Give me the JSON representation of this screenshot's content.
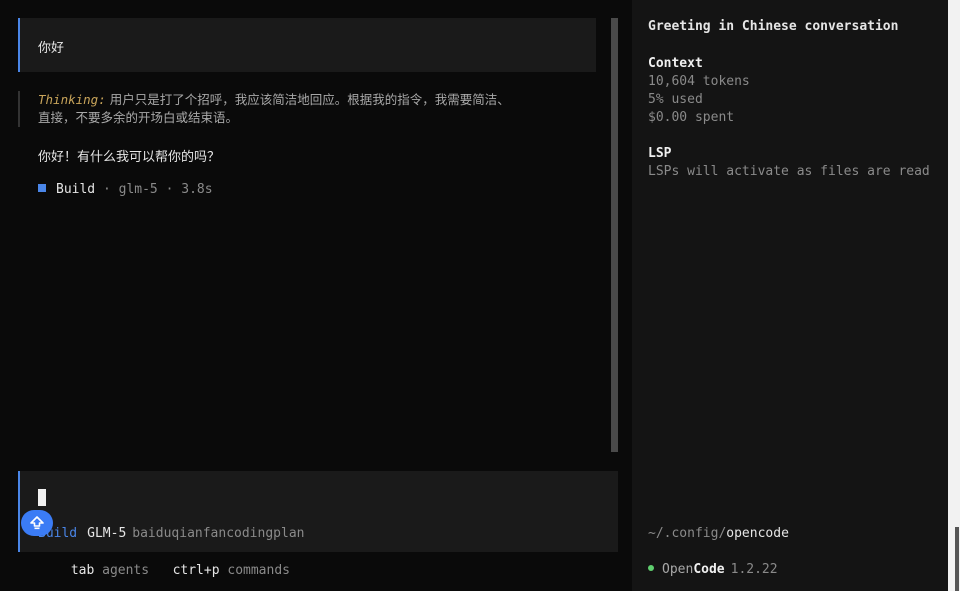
{
  "conversation": {
    "user_message": "你好",
    "thinking_label": "Thinking:",
    "thinking_line1": "用户只是打了个招呼，我应该简洁地回应。根据我的指令，我需要简洁、",
    "thinking_line2": "直接，不要多余的开场白或结束语。",
    "assistant_reply": "你好！有什么我可以帮你的吗？",
    "build": {
      "agent": "Build",
      "sep1": "·",
      "model": "glm-5",
      "sep2": "·",
      "duration": "3.8s"
    }
  },
  "input": {
    "agent": "Build",
    "model": "GLM-5",
    "provider": "baiduqianfancodingplan"
  },
  "hints": {
    "tab_key": "tab",
    "tab_desc": "agents",
    "cmd_key": "ctrl+p",
    "cmd_desc": "commands"
  },
  "sidebar": {
    "title": "Greeting in Chinese conversation",
    "context": {
      "heading": "Context",
      "tokens": "10,604 tokens",
      "used": "5% used",
      "spent": "$0.00 spent"
    },
    "lsp": {
      "heading": "LSP",
      "status": "LSPs will activate as files are read"
    },
    "path_prefix": "~/.config/",
    "path_dir": "opencode",
    "brand_open": "Open",
    "brand_code": "Code",
    "version": "1.2.22"
  },
  "colors": {
    "accent": "#4a86e8",
    "status_dot": "#5fcf6f",
    "thinking_label": "#c8a45a"
  }
}
